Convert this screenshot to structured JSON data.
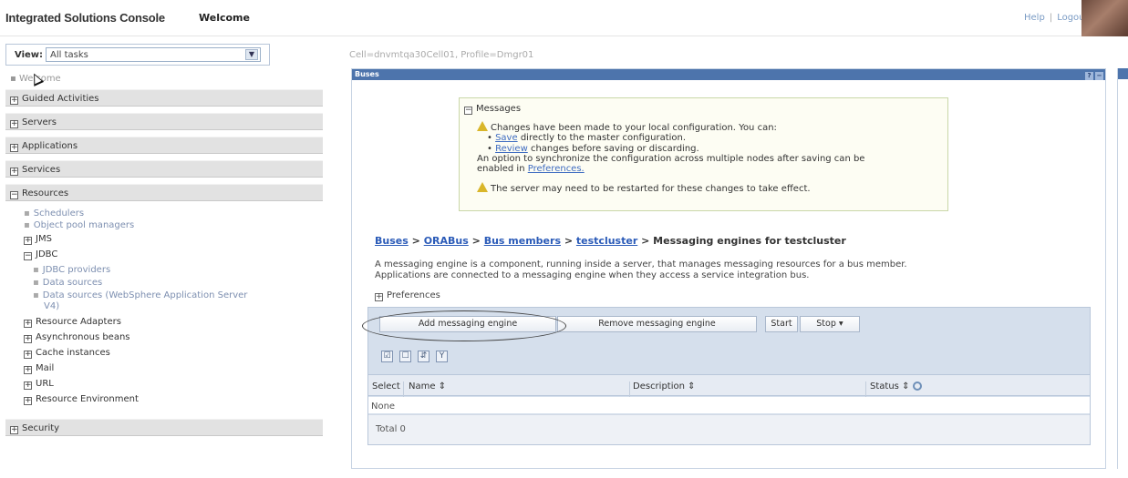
{
  "banner": {
    "title": "Integrated Solutions Console",
    "welcome": "Welcome",
    "help": "Help",
    "separator": "|",
    "logout": "Logout"
  },
  "nav": {
    "view_label": "View:",
    "view_value": "All tasks",
    "welcome_link": "Welcome",
    "categories": [
      "Guided Activities",
      "Servers",
      "Applications",
      "Services",
      "Resources",
      "Security"
    ],
    "resources_items": {
      "schedulers": "Schedulers",
      "object_pool": "Object pool managers",
      "jms": "JMS",
      "jdbc": "JDBC",
      "jdbc_providers": "JDBC providers",
      "data_sources": "Data sources",
      "data_sources_v4": "Data sources (WebSphere Application Server",
      "data_sources_v4_cont": "V4)",
      "resource_adapters": "Resource Adapters",
      "async_beans": "Asynchronous beans",
      "cache_instances": "Cache instances",
      "mail": "Mail",
      "url": "URL",
      "resource_env": "Resource Environment"
    }
  },
  "main": {
    "cell_profile": "Cell=dnvmtqa30Cell01, Profile=Dmgr01",
    "panel_title": "Buses",
    "messages": {
      "header": "Messages",
      "line1": "Changes have been made to your local configuration. You can:",
      "save_link": "Save",
      "save_rest": "directly to the master configuration.",
      "review_link": "Review",
      "review_rest": "changes before saving or discarding.",
      "sync1": "An option to synchronize the configuration across multiple nodes after saving can be",
      "sync2_prefix": "enabled in",
      "prefs_link": "Preferences.",
      "restart": "The server may need to be restarted for these changes to take effect."
    },
    "breadcrumb": {
      "buses": "Buses",
      "sep": ">",
      "orabus": "ORABus",
      "bus_members": "Bus members",
      "testcluster": "testcluster",
      "current": "Messaging engines for testcluster"
    },
    "description1": "A messaging engine is a component, running inside a server, that manages messaging resources for a bus member.",
    "description2": "Applications are connected to a messaging engine when they access a service integration bus.",
    "preferences": "Preferences",
    "buttons": {
      "add": "Add messaging engine",
      "remove": "Remove messaging engine",
      "start": "Start",
      "stop": "Stop"
    },
    "table": {
      "select": "Select",
      "name": "Name",
      "description": "Description",
      "status": "Status",
      "none": "None",
      "total": "Total 0"
    }
  },
  "colors": {
    "panel_header": "#4d74ac",
    "nav_category": "#e2e2e2",
    "link": "#3f6cc1"
  }
}
